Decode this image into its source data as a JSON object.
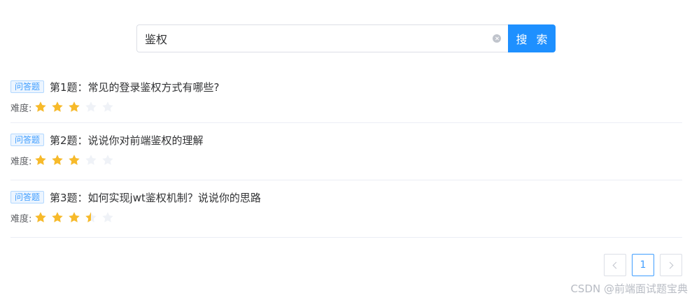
{
  "search": {
    "value": "鉴权",
    "button_label": "搜 索"
  },
  "questions": [
    {
      "tag": "问答题",
      "title": "第1题：常见的登录鉴权方式有哪些?",
      "difficulty_label": "难度:",
      "rating": 3,
      "max_rating": 5
    },
    {
      "tag": "问答题",
      "title": "第2题：说说你对前端鉴权的理解",
      "difficulty_label": "难度:",
      "rating": 3,
      "max_rating": 5
    },
    {
      "tag": "问答题",
      "title": "第3题：如何实现jwt鉴权机制？说说你的思路",
      "difficulty_label": "难度:",
      "rating": 3.5,
      "max_rating": 5
    }
  ],
  "pagination": {
    "current_page": "1",
    "prev_icon": "chevron-left-icon",
    "next_icon": "chevron-right-icon"
  },
  "watermark": "CSDN @前端面试题宝典",
  "colors": {
    "accent": "#1e90ff",
    "star_filled": "#f7ba2a",
    "star_empty": "#eff2f7",
    "tag_text": "#409eff"
  }
}
